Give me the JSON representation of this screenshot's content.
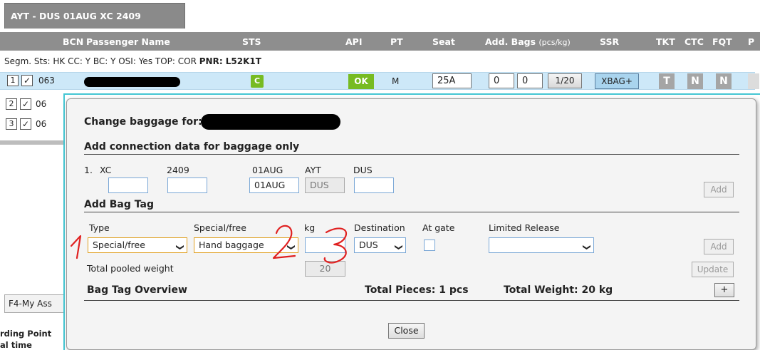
{
  "flight_tab": "AYT - DUS 01AUG XC 2409",
  "columns": {
    "bcn": "BCN",
    "passenger_name": "Passenger Name",
    "sts": "STS",
    "api": "API",
    "pt": "PT",
    "seat": "Seat",
    "add_bags": "Add. Bags",
    "add_bags_unit": "(pcs/kg)",
    "ssr": "SSR",
    "tkt": "TKT",
    "ctc": "CTC",
    "fqt": "FQT",
    "p": "P"
  },
  "segment": {
    "text": "Segm. Sts: HK  CC: Y  BC: Y  OSI: Yes  TOP: COR ",
    "pnr_label": "PNR: L52K1T"
  },
  "passengers": [
    {
      "num": "1",
      "check": "✓",
      "bcn": "063",
      "sts": "C",
      "api": "OK",
      "pt": "M",
      "seat": "25A",
      "bags_pcs": "0",
      "bags_kg": "0",
      "bag_ratio": "1/20",
      "ssr": "XBAG+",
      "tkt": "T",
      "ctc": "N",
      "fqt": "N"
    },
    {
      "num": "2",
      "check": "✓",
      "bcn": "06"
    },
    {
      "num": "3",
      "check": "✓",
      "bcn": "06"
    }
  ],
  "left_tab": "F4-My Ass",
  "left_footer": [
    "rding Point",
    "al time"
  ],
  "dialog": {
    "title": "Change baggage for: ",
    "connection_section": "Add connection data for baggage only",
    "conn_index": "1.",
    "conn_airline": "XC",
    "conn_flight": "2409",
    "conn_date": "01AUG",
    "conn_from": "AYT",
    "conn_to": "DUS",
    "conn_date_value": "01AUG",
    "conn_from_value": "DUS",
    "add_label": "Add",
    "bagtag_section": "Add Bag Tag",
    "type_label": "Type",
    "special_label": "Special/free",
    "kg_label": "kg",
    "destination_label": "Destination",
    "at_gate_label": "At gate",
    "limited_release_label": "Limited Release",
    "type_value": "Special/free",
    "special_value": "Hand baggage",
    "kg_value": "",
    "destination_value": "DUS",
    "limited_release_value": "",
    "pooled_label": "Total pooled weight",
    "pooled_value": "20",
    "update_label": "Update",
    "overview_label": "Bag Tag Overview",
    "total_pieces": "Total Pieces:  1 pcs",
    "total_weight": "Total Weight:   20 kg",
    "plus_label": "+",
    "close_label": "Close"
  },
  "annotations": [
    "1",
    "2",
    "3"
  ],
  "colors": {
    "header_grey": "#8e8e8e",
    "selected_row": "#cde8f8",
    "status_green": "#77bb22",
    "ssr_blue": "#a9d4ee",
    "frame_teal": "#44c6d3",
    "annotation_red": "#e02020"
  }
}
